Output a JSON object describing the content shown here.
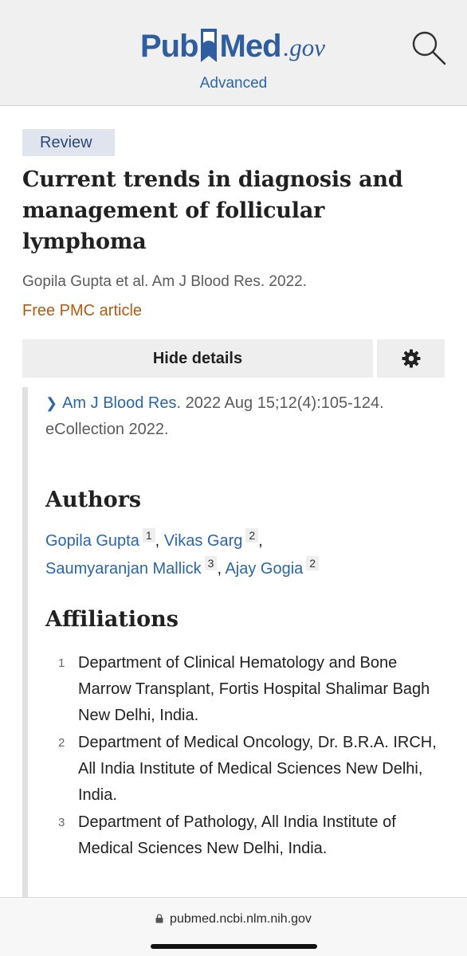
{
  "header": {
    "logo_pub": "Pub",
    "logo_med": "Med",
    "logo_gov": ".gov",
    "advanced": "Advanced",
    "search_icon": "search-icon"
  },
  "article": {
    "badge": "Review",
    "title": "Current trends in diagnosis and management of follicular lymphoma",
    "citation_line": "Gopila Gupta et al. Am J Blood Res. 2022.",
    "free_pmc": "Free PMC article",
    "hide_details": "Hide details",
    "settings_icon": "gear-icon",
    "journal": {
      "name": "Am J Blood Res.",
      "details": "2022 Aug 15;12(4):105-124. eCollection 2022."
    },
    "authors_heading": "Authors",
    "authors": [
      {
        "name": "Gopila Gupta",
        "aff": "1"
      },
      {
        "name": "Vikas Garg",
        "aff": "2"
      },
      {
        "name": "Saumyaranjan Mallick",
        "aff": "3"
      },
      {
        "name": "Ajay Gogia",
        "aff": "2"
      }
    ],
    "affiliations_heading": "Affiliations",
    "affiliations": [
      {
        "num": "1",
        "text": "Department of Clinical Hematology and Bone Marrow Transplant, Fortis Hospital Shalimar Bagh New Delhi, India."
      },
      {
        "num": "2",
        "text": "Department of Medical Oncology, Dr. B.R.A. IRCH, All India Institute of Medical Sciences New Delhi, India."
      },
      {
        "num": "3",
        "text": "Department of Pathology, All India Institute of Medical Sciences New Delhi, India."
      }
    ]
  },
  "browser": {
    "url": "pubmed.ncbi.nlm.nih.gov",
    "lock_icon": "lock-icon"
  },
  "colors": {
    "brand_blue": "#2f5ea0",
    "link_blue": "#2a66a8",
    "pmc_orange": "#b25a10",
    "badge_bg": "#dfe4ee"
  }
}
